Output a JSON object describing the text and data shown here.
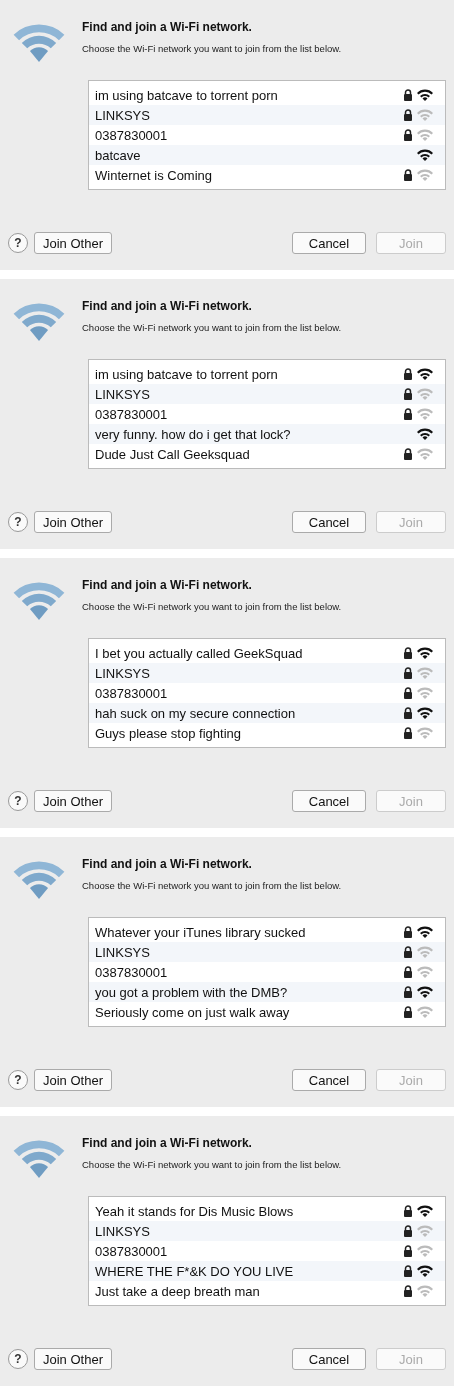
{
  "dialogs": [
    {
      "title": "Find and join a Wi-Fi network.",
      "subtitle": "Choose the Wi-Fi network you want to join from the list below.",
      "networks": [
        {
          "name": "im using batcave to torrent porn",
          "locked": true,
          "strong": true
        },
        {
          "name": "LINKSYS",
          "locked": true,
          "strong": false
        },
        {
          "name": "0387830001",
          "locked": true,
          "strong": false
        },
        {
          "name": "batcave",
          "locked": false,
          "strong": true
        },
        {
          "name": "Winternet is Coming",
          "locked": true,
          "strong": false
        }
      ],
      "help": "?",
      "join_other": "Join Other",
      "cancel": "Cancel",
      "join": {
        "label": "Join",
        "disabled": true
      }
    },
    {
      "title": "Find and join a Wi-Fi network.",
      "subtitle": "Choose the Wi-Fi network you want to join from the list below.",
      "networks": [
        {
          "name": "im using batcave to torrent porn",
          "locked": true,
          "strong": true
        },
        {
          "name": "LINKSYS",
          "locked": true,
          "strong": false
        },
        {
          "name": "0387830001",
          "locked": true,
          "strong": false
        },
        {
          "name": "very funny. how do i get that lock?",
          "locked": false,
          "strong": true
        },
        {
          "name": "Dude Just Call Geeksquad",
          "locked": true,
          "strong": false
        }
      ],
      "help": "?",
      "join_other": "Join Other",
      "cancel": "Cancel",
      "join": {
        "label": "Join",
        "disabled": true
      }
    },
    {
      "title": "Find and join a Wi-Fi network.",
      "subtitle": "Choose the Wi-Fi network you want to join from the list below.",
      "networks": [
        {
          "name": "I bet you actually called GeekSquad",
          "locked": true,
          "strong": true
        },
        {
          "name": "LINKSYS",
          "locked": true,
          "strong": false
        },
        {
          "name": "0387830001",
          "locked": true,
          "strong": false
        },
        {
          "name": "hah suck on my secure connection",
          "locked": true,
          "strong": true
        },
        {
          "name": "Guys please stop fighting",
          "locked": true,
          "strong": false
        }
      ],
      "help": "?",
      "join_other": "Join Other",
      "cancel": "Cancel",
      "join": {
        "label": "Join",
        "disabled": true
      }
    },
    {
      "title": "Find and join a Wi-Fi network.",
      "subtitle": "Choose the Wi-Fi network you want to join from the list below.",
      "networks": [
        {
          "name": "Whatever your iTunes library sucked",
          "locked": true,
          "strong": true
        },
        {
          "name": "LINKSYS",
          "locked": true,
          "strong": false
        },
        {
          "name": "0387830001",
          "locked": true,
          "strong": false
        },
        {
          "name": "you got a problem with the DMB?",
          "locked": true,
          "strong": true
        },
        {
          "name": "Seriously come on just walk away",
          "locked": true,
          "strong": false
        }
      ],
      "help": "?",
      "join_other": "Join Other",
      "cancel": "Cancel",
      "join": {
        "label": "Join",
        "disabled": true
      }
    },
    {
      "title": "Find and join a Wi-Fi network.",
      "subtitle": "Choose the Wi-Fi network you want to join from the list below.",
      "networks": [
        {
          "name": "Yeah it stands for Dis Music Blows",
          "locked": true,
          "strong": true
        },
        {
          "name": "LINKSYS",
          "locked": true,
          "strong": false
        },
        {
          "name": "0387830001",
          "locked": true,
          "strong": false
        },
        {
          "name": "WHERE THE F*&K DO YOU LIVE",
          "locked": true,
          "strong": true
        },
        {
          "name": "Just take a deep breath man",
          "locked": true,
          "strong": false
        }
      ],
      "help": "?",
      "join_other": "Join Other",
      "cancel": "Cancel",
      "join": {
        "label": "Join",
        "disabled": true
      }
    }
  ]
}
